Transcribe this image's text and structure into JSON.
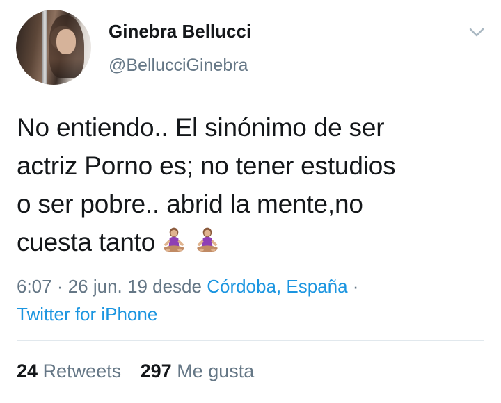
{
  "user": {
    "display_name": "Ginebra Bellucci",
    "handle": "@BellucciGinebra"
  },
  "tweet": {
    "text": "No entiendo.. El sinónimo de ser\nactriz Porno es; no tener estudios\no ser pobre.. abrid la mente,no\ncuesta tanto",
    "emojis": [
      "person-in-lotus-position-icon",
      "person-in-lotus-position-icon"
    ]
  },
  "meta": {
    "time_date": "6:07 · 26 jun. 19 desde ",
    "location": "Córdoba, España",
    "separator": " ·",
    "client": "Twitter for iPhone"
  },
  "stats": {
    "retweets_count": "24",
    "retweets_label": "Retweets",
    "likes_count": "297",
    "likes_label": "Me gusta"
  },
  "colors": {
    "link": "#1b95e0",
    "secondary_text": "#657786",
    "primary_text": "#14171a",
    "divider": "#e1e8ed"
  }
}
